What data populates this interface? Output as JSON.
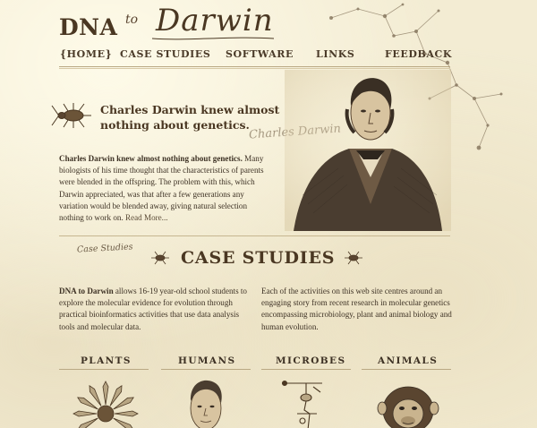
{
  "brand": {
    "dna": "DNA",
    "to": "to",
    "darwin": "Darwin"
  },
  "nav": {
    "items": [
      {
        "label": "{HOME}"
      },
      {
        "label": "CASE STUDIES"
      },
      {
        "label": "SOFTWARE"
      },
      {
        "label": "LINKS"
      },
      {
        "label": "FEEDBACK"
      }
    ]
  },
  "intro": {
    "heading": "Charles Darwin knew almost nothing about genetics.",
    "lead": "Charles Darwin knew almost nothing about genetics.",
    "body": " Many biologists of his time thought that the characteristics of parents were blended in the offspring. The problem with this, which Darwin appreciated, was that after a few generations any variation would be blended away, giving natural selection nothing to work on.",
    "read_more": " Read More..."
  },
  "case_studies": {
    "script_label": "Case Studies",
    "heading": "CASE STUDIES",
    "col1_lead": "DNA to Darwin",
    "col1_body": " allows 16-19 year-old school students to explore the molecular evidence for evolution through practical bioinformatics activities that use data analysis tools and molecular data.",
    "col2_body": "Each of the activities on this web site centres around an engaging story from recent research in molecular genetics encompassing microbiology, plant and animal biology and human evolution."
  },
  "categories": [
    {
      "label": "PLANTS",
      "icon": "flower-icon"
    },
    {
      "label": "HUMANS",
      "icon": "human-portrait-icon"
    },
    {
      "label": "MICROBES",
      "icon": "microscope-icon"
    },
    {
      "label": "ANIMALS",
      "icon": "chimpanzee-icon"
    }
  ],
  "colors": {
    "background": "#f3ecd3",
    "ink": "#4a3722",
    "rule": "#b9a883"
  }
}
